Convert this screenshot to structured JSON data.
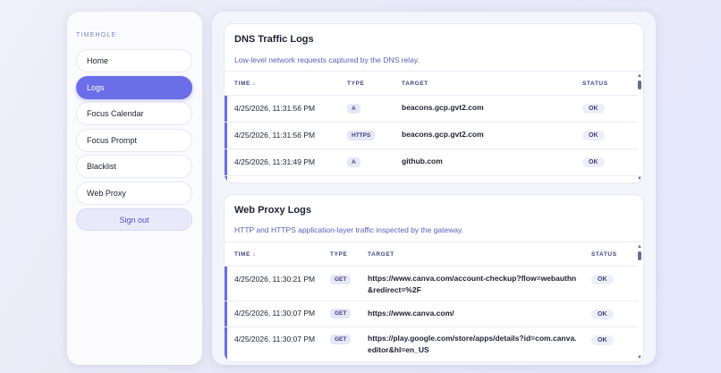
{
  "sidebar": {
    "brand": "TIMEHOLE",
    "items": [
      {
        "label": "Home"
      },
      {
        "label": "Logs"
      },
      {
        "label": "Focus Calendar"
      },
      {
        "label": "Focus Prompt"
      },
      {
        "label": "Blacklist"
      },
      {
        "label": "Web Proxy"
      }
    ],
    "active_index": 1,
    "signout_label": "Sign out"
  },
  "dns": {
    "title": "DNS Traffic Logs",
    "subtitle": "Low-level network requests captured by the DNS relay.",
    "columns": {
      "time": "TIME ↓",
      "type": "TYPE",
      "target": "TARGET",
      "status": "STATUS"
    },
    "rows": [
      {
        "time": "4/25/2026, 11:31:56 PM",
        "type": "A",
        "target": "beacons.gcp.gvt2.com",
        "status": "OK"
      },
      {
        "time": "4/25/2026, 11:31:56 PM",
        "type": "HTTPS",
        "target": "beacons.gcp.gvt2.com",
        "status": "OK"
      },
      {
        "time": "4/25/2026, 11:31:49 PM",
        "type": "A",
        "target": "github.com",
        "status": "OK"
      }
    ]
  },
  "proxy": {
    "title": "Web Proxy Logs",
    "subtitle": "HTTP and HTTPS application-layer traffic inspected by the gateway.",
    "columns": {
      "time": "TIME ↓",
      "type": "TYPE",
      "target": "TARGET",
      "status": "STATUS"
    },
    "rows": [
      {
        "time": "4/25/2026, 11:30:21 PM",
        "type": "GET",
        "target_line1": "https://www.canva.com/account-checkup?flow=webauthn",
        "target_line2": "&redirect=%2F",
        "status": "OK"
      },
      {
        "time": "4/25/2026, 11:30:07 PM",
        "type": "GET",
        "target_line1": "https://www.canva.com/",
        "target_line2": "",
        "status": "OK"
      },
      {
        "time": "4/25/2026, 11:30:07 PM",
        "type": "GET",
        "target_line1": "https://play.google.com/store/apps/details?id=com.canva.",
        "target_line2": "editor&hl=en_US",
        "status": "OK"
      }
    ]
  },
  "colors": {
    "accent": "#6a6ee9",
    "badge_bg": "#e6e7f7"
  },
  "icons": {
    "scroll_up": "scroll-up-arrow-icon",
    "scroll_down": "scroll-down-arrow-icon"
  }
}
